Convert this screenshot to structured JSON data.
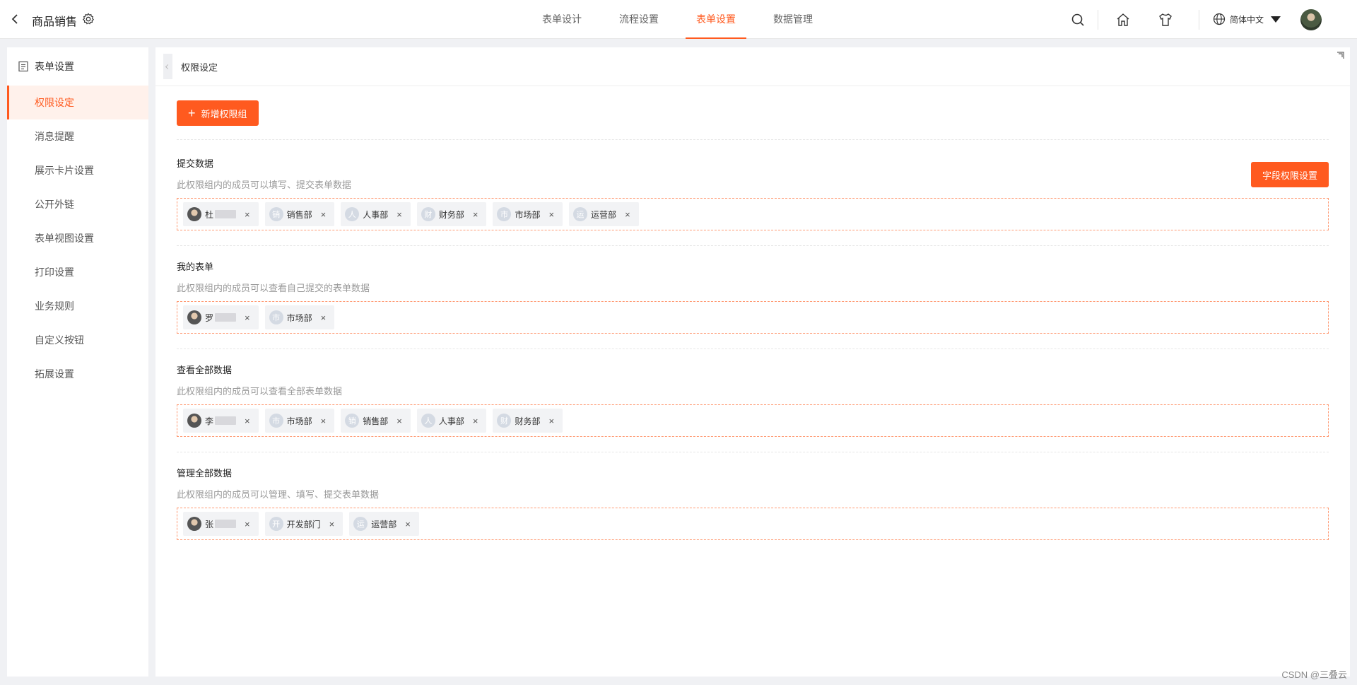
{
  "header": {
    "title": "商品销售",
    "tabs": [
      {
        "label": "表单设计"
      },
      {
        "label": "流程设置"
      },
      {
        "label": "表单设置",
        "active": true
      },
      {
        "label": "数据管理"
      }
    ],
    "language": "简体中文",
    "accent_color": "#ff5a1f"
  },
  "sidebar": {
    "heading": "表单设置",
    "items": [
      {
        "label": "权限设定",
        "active": true
      },
      {
        "label": "消息提醒"
      },
      {
        "label": "展示卡片设置"
      },
      {
        "label": "公开外链"
      },
      {
        "label": "表单视图设置"
      },
      {
        "label": "打印设置"
      },
      {
        "label": "业务规则"
      },
      {
        "label": "自定义按钮"
      },
      {
        "label": "拓展设置"
      }
    ]
  },
  "main": {
    "title": "权限设定",
    "add_button": "新增权限组",
    "field_permission_button": "字段权限设置",
    "groups": [
      {
        "title": "提交数据",
        "desc": "此权限组内的成员可以填写、提交表单数据",
        "members": [
          {
            "type": "user",
            "name": "杜"
          },
          {
            "type": "dept",
            "badge": "销",
            "name": "销售部"
          },
          {
            "type": "dept",
            "badge": "人",
            "name": "人事部"
          },
          {
            "type": "dept",
            "badge": "财",
            "name": "财务部"
          },
          {
            "type": "dept",
            "badge": "市",
            "name": "市场部"
          },
          {
            "type": "dept",
            "badge": "运",
            "name": "运营部"
          }
        ]
      },
      {
        "title": "我的表单",
        "desc": "此权限组内的成员可以查看自己提交的表单数据",
        "members": [
          {
            "type": "user",
            "name": "罗"
          },
          {
            "type": "dept",
            "badge": "市",
            "name": "市场部"
          }
        ]
      },
      {
        "title": "查看全部数据",
        "desc": "此权限组内的成员可以查看全部表单数据",
        "members": [
          {
            "type": "user",
            "name": "李"
          },
          {
            "type": "dept",
            "badge": "市",
            "name": "市场部"
          },
          {
            "type": "dept",
            "badge": "销",
            "name": "销售部"
          },
          {
            "type": "dept",
            "badge": "人",
            "name": "人事部"
          },
          {
            "type": "dept",
            "badge": "财",
            "name": "财务部"
          }
        ]
      },
      {
        "title": "管理全部数据",
        "desc": "此权限组内的成员可以管理、填写、提交表单数据",
        "members": [
          {
            "type": "user",
            "name": "张"
          },
          {
            "type": "dept",
            "badge": "开",
            "name": "开发部门"
          },
          {
            "type": "dept",
            "badge": "运",
            "name": "运营部"
          }
        ]
      }
    ]
  },
  "watermark": "CSDN @三叠云"
}
